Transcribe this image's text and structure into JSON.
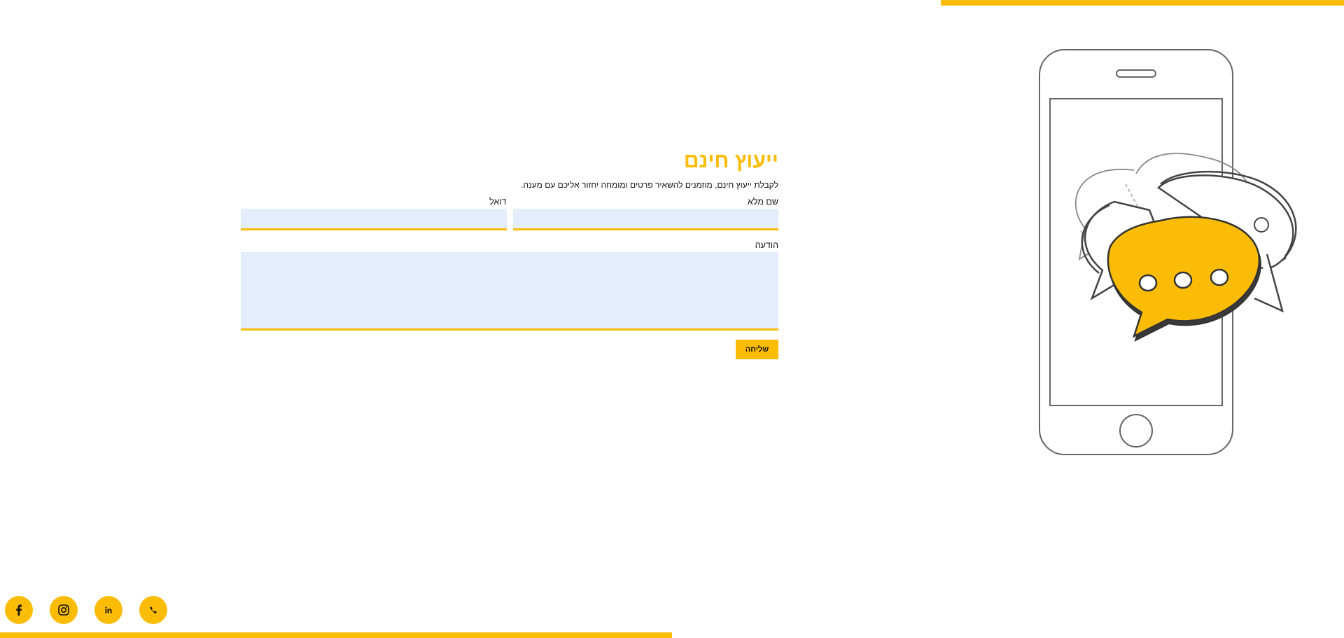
{
  "form": {
    "title": "ייעוץ חינם",
    "description": "לקבלת ייעוץ חינם, מוזמנים להשאיר פרטים ומומחה יחזור אליכם עם מענה.",
    "fields": {
      "full_name_label": "שם מלא",
      "email_label": "דואל",
      "message_label": "הודעה"
    },
    "submit_label": "שליחה"
  },
  "social": [
    {
      "icon": "facebook-icon"
    },
    {
      "icon": "instagram-icon"
    },
    {
      "icon": "linkedin-icon"
    },
    {
      "icon": "phone-icon"
    }
  ],
  "colors": {
    "accent": "#FBBC05",
    "input_bg": "#E4EDFC",
    "text": "#111111"
  }
}
